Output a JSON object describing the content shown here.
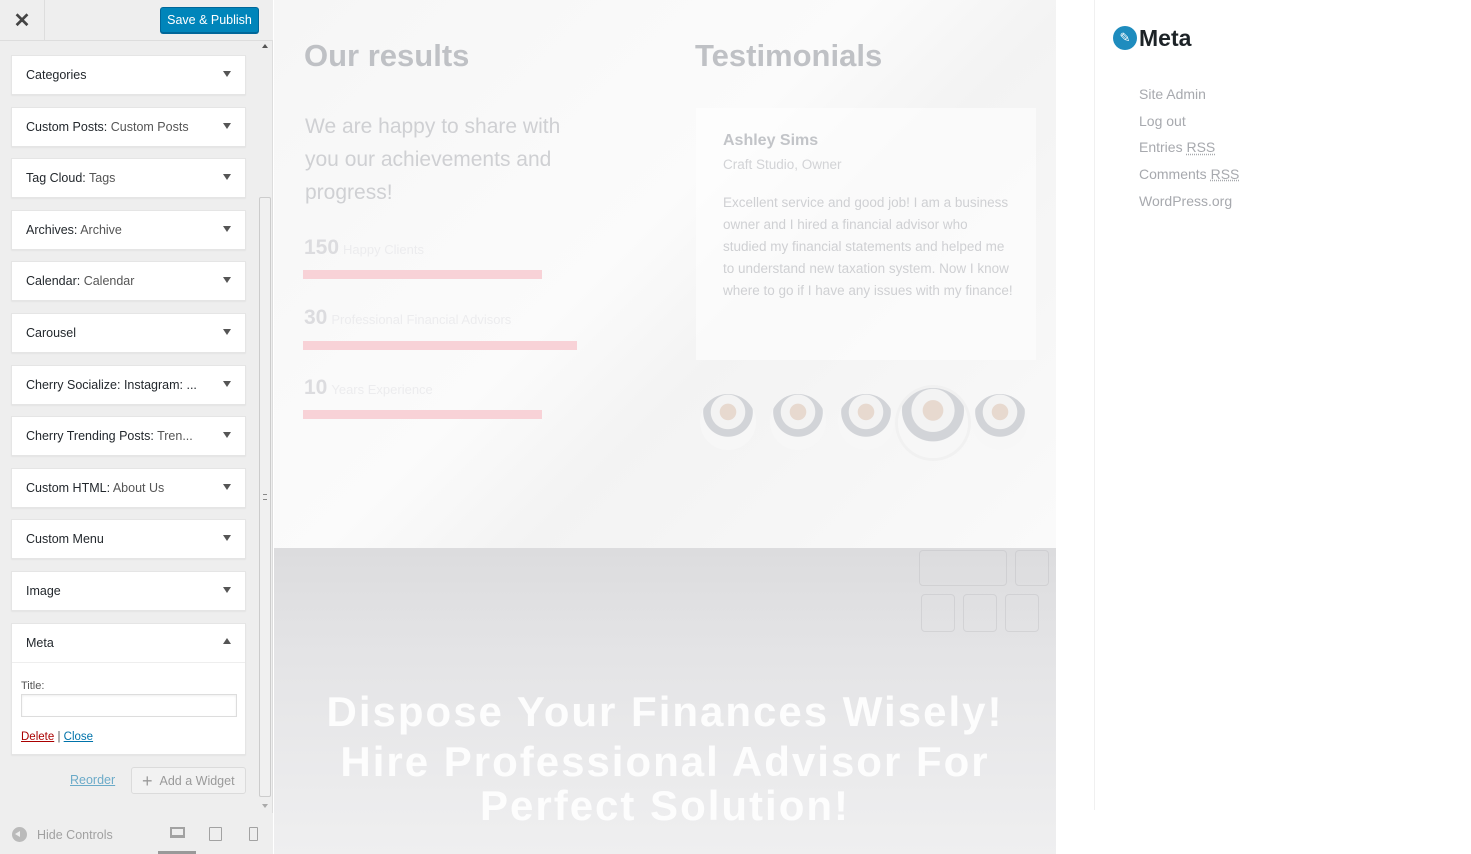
{
  "topbar": {
    "close_icon": "close-icon",
    "save_label": "Save & Publish"
  },
  "widgets": [
    {
      "name": "Categories",
      "instance": ""
    },
    {
      "name": "Custom Posts:",
      "instance": "Custom Posts"
    },
    {
      "name": "Tag Cloud:",
      "instance": "Tags"
    },
    {
      "name": "Archives:",
      "instance": "Archive"
    },
    {
      "name": "Calendar:",
      "instance": "Calendar"
    },
    {
      "name": "Carousel",
      "instance": ""
    },
    {
      "name": "Cherry Socialize: Instagram: ...",
      "instance": ""
    },
    {
      "name": "Cherry Trending Posts:",
      "instance": "Tren..."
    },
    {
      "name": "Custom HTML:",
      "instance": "About Us"
    },
    {
      "name": "Custom Menu",
      "instance": ""
    },
    {
      "name": "Image",
      "instance": ""
    }
  ],
  "meta_widget": {
    "name": "Meta",
    "title_label": "Title:",
    "title_value": "",
    "delete_label": "Delete",
    "separator": "|",
    "close_label": "Close"
  },
  "panel_actions": {
    "reorder_label": "Reorder",
    "add_widget_label": "Add a Widget"
  },
  "footer": {
    "hide_controls_label": "Hide Controls",
    "devices": [
      "desktop-icon",
      "tablet-icon",
      "mobile-icon"
    ]
  },
  "preview": {
    "results_heading": "Our results",
    "results_lede": "We are happy to share with you our achievements and progress!",
    "stats": [
      {
        "number": "150",
        "label": "Happy Clients",
        "progress": 0.63
      },
      {
        "number": "30",
        "label": "Professional Financial Advisors",
        "progress": 0.72
      },
      {
        "number": "10",
        "label": "Years Experience",
        "progress": 0.63
      }
    ],
    "testimonials_heading": "Testimonials",
    "testimonial": {
      "name": "Ashley Sims",
      "role": "Craft Studio, Owner",
      "text": "Excellent service and good job! I am a business owner and I hired a financial advisor who studied my financial statements and helped me to understand new taxation system. Now I know where to go if I have any issues with my finance!"
    },
    "hero_line1": "Dispose Your Finances Wisely!",
    "hero_line2": "Hire Professional Advisor For",
    "hero_line3": "Perfect Solution!"
  },
  "sidebar": {
    "meta_heading": "Meta",
    "links": [
      {
        "text": "Site Admin",
        "abbr": ""
      },
      {
        "text": "Log out",
        "abbr": ""
      },
      {
        "text": "Entries ",
        "abbr": "RSS"
      },
      {
        "text": "Comments ",
        "abbr": "RSS"
      },
      {
        "text": "WordPress.org",
        "abbr": ""
      }
    ]
  },
  "colors": {
    "primary_button": "#0085ba",
    "link": "#0073aa",
    "delete": "#a00",
    "progress": "#f8d2d7",
    "meta_icon": "#1e8cbe"
  }
}
